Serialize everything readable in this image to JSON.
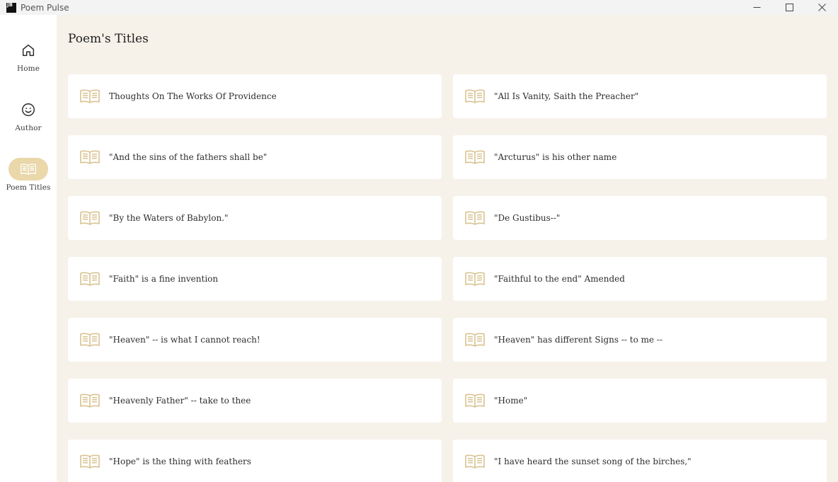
{
  "window": {
    "title": "Poem Pulse",
    "icon": "jetbrains-app-icon",
    "icon_text": "JB",
    "controls": [
      "minimize-icon",
      "maximize-icon",
      "close-icon"
    ]
  },
  "sidebar": {
    "items": [
      {
        "label": "Home",
        "icon": "home-icon",
        "active": false
      },
      {
        "label": "Author",
        "icon": "smiley-face-icon",
        "active": false
      },
      {
        "label": "Poem Titles",
        "icon": "open-book-icon",
        "active": true
      }
    ]
  },
  "main": {
    "title": "Poem's Titles",
    "card_icon": "open-book-icon",
    "poems": [
      "Thoughts On The Works Of Providence",
      "\"All Is Vanity, Saith the Preacher\"",
      "\"And the sins of the fathers shall be\"",
      "\"Arcturus\" is his other name",
      "\"By the Waters of Babylon.\"",
      "\"De Gustibus--\"",
      "\"Faith\" is a fine invention",
      "\"Faithful to the end\" Amended",
      "\"Heaven\" -- is what I cannot reach!",
      "\"Heaven\" has different Signs -- to me --",
      "\"Heavenly Father\" -- take to thee",
      "\"Home\"",
      "\"Hope\" is the thing with feathers",
      "\"I have heard the sunset song of the birches,\""
    ]
  },
  "colors": {
    "background": "#f6f2ea",
    "accent": "#ead7aa",
    "icon": "#d9c391",
    "card": "#ffffff"
  }
}
